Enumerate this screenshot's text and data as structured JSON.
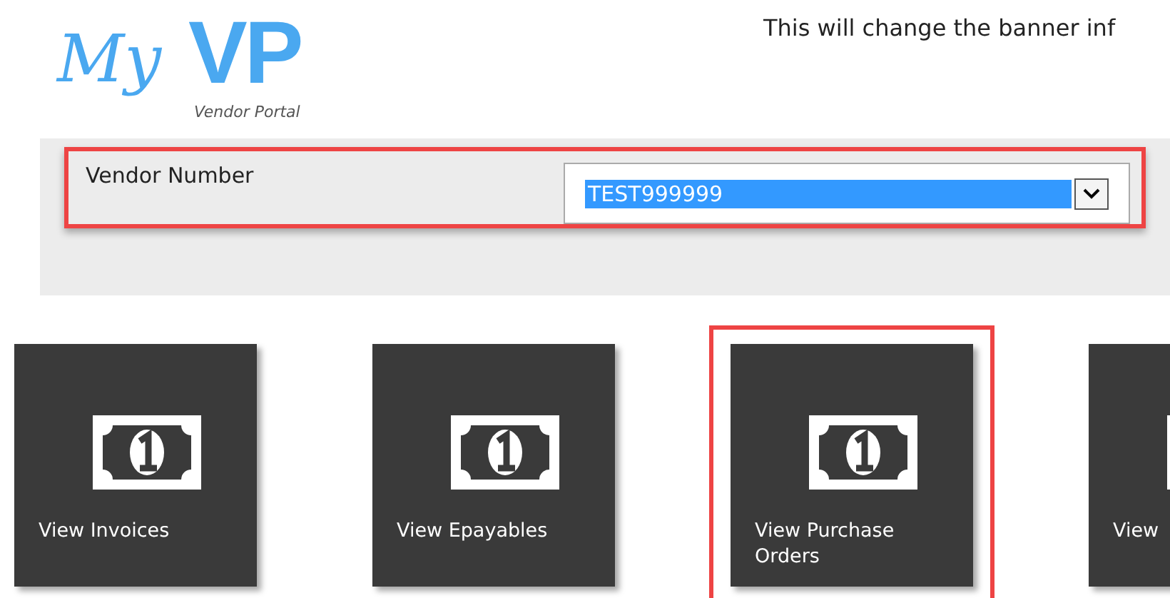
{
  "logo": {
    "script": "My",
    "letters": "VP",
    "tagline": "Vendor Portal"
  },
  "banner_text": "This will change the banner inf",
  "vendor": {
    "label": "Vendor Number",
    "value": "TEST999999",
    "highlighted": true
  },
  "tiles": [
    {
      "label": "View Invoices",
      "highlighted": false
    },
    {
      "label": "View Epayables",
      "highlighted": false
    },
    {
      "label": "View Purchase Orders",
      "highlighted": true
    },
    {
      "label": "View",
      "highlighted": false
    }
  ]
}
